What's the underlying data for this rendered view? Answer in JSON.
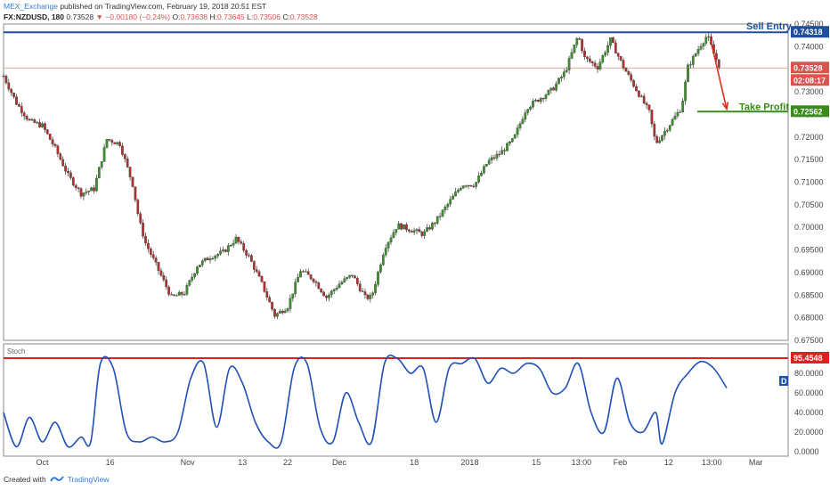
{
  "header": {
    "publisher": "MEX_Exchange",
    "published_text": "published on TradingView.com, February 19, 2018 20:51 EST",
    "symbol": "FX:NZDUSD, 180",
    "last": "0.73528",
    "change": "−0.00180 (−0.24%)",
    "o_label": "O:",
    "o": "0.73638",
    "h_label": "H:",
    "h": "0.73645",
    "l_label": "L:",
    "l": "0.73506",
    "c_label": "C:",
    "c": "0.73528"
  },
  "footer": {
    "created_with": "Created with",
    "brand": "TradingView"
  },
  "chart_data": {
    "type": "candlestick",
    "symbol": "NZDUSD",
    "timeframe": "180",
    "price_axis": {
      "min": 0.675,
      "max": 0.745,
      "ticks": [
        "0.74500",
        "0.74000",
        "0.73500",
        "0.73000",
        "0.72500",
        "0.72000",
        "0.71500",
        "0.71000",
        "0.70500",
        "0.70000",
        "0.69500",
        "0.69000",
        "0.68500",
        "0.68000",
        "0.67500"
      ]
    },
    "time_axis": {
      "labels": [
        {
          "t": 0.06,
          "text": "Oct"
        },
        {
          "t": 0.165,
          "text": "16"
        },
        {
          "t": 0.285,
          "text": "Nov"
        },
        {
          "t": 0.37,
          "text": "13"
        },
        {
          "t": 0.44,
          "text": "22"
        },
        {
          "t": 0.52,
          "text": "Dec"
        },
        {
          "t": 0.636,
          "text": "18"
        },
        {
          "t": 0.722,
          "text": "2018"
        },
        {
          "t": 0.825,
          "text": "15"
        },
        {
          "t": 0.895,
          "text": "13:00"
        },
        {
          "t": 0.955,
          "text": "Feb"
        },
        {
          "t": 1.03,
          "text": "12"
        },
        {
          "t": 1.097,
          "text": "13:00"
        },
        {
          "t": 1.165,
          "text": "Mar"
        }
      ]
    },
    "price_path": [
      {
        "t": 0.0,
        "p": 0.7335
      },
      {
        "t": 0.02,
        "p": 0.7275
      },
      {
        "t": 0.04,
        "p": 0.7235
      },
      {
        "t": 0.06,
        "p": 0.7225
      },
      {
        "t": 0.08,
        "p": 0.7175
      },
      {
        "t": 0.1,
        "p": 0.7115
      },
      {
        "t": 0.12,
        "p": 0.7075
      },
      {
        "t": 0.14,
        "p": 0.7085
      },
      {
        "t": 0.16,
        "p": 0.7195
      },
      {
        "t": 0.18,
        "p": 0.7185
      },
      {
        "t": 0.2,
        "p": 0.7095
      },
      {
        "t": 0.21,
        "p": 0.7015
      },
      {
        "t": 0.22,
        "p": 0.6965
      },
      {
        "t": 0.24,
        "p": 0.6905
      },
      {
        "t": 0.26,
        "p": 0.6845
      },
      {
        "t": 0.28,
        "p": 0.6855
      },
      {
        "t": 0.3,
        "p": 0.6915
      },
      {
        "t": 0.32,
        "p": 0.6935
      },
      {
        "t": 0.34,
        "p": 0.6945
      },
      {
        "t": 0.36,
        "p": 0.6975
      },
      {
        "t": 0.38,
        "p": 0.6935
      },
      {
        "t": 0.4,
        "p": 0.6875
      },
      {
        "t": 0.42,
        "p": 0.6805
      },
      {
        "t": 0.44,
        "p": 0.6825
      },
      {
        "t": 0.46,
        "p": 0.6905
      },
      {
        "t": 0.48,
        "p": 0.6885
      },
      {
        "t": 0.5,
        "p": 0.6845
      },
      {
        "t": 0.52,
        "p": 0.6875
      },
      {
        "t": 0.54,
        "p": 0.6895
      },
      {
        "t": 0.56,
        "p": 0.6845
      },
      {
        "t": 0.57,
        "p": 0.6845
      },
      {
        "t": 0.59,
        "p": 0.6955
      },
      {
        "t": 0.61,
        "p": 0.7005
      },
      {
        "t": 0.63,
        "p": 0.6995
      },
      {
        "t": 0.65,
        "p": 0.6985
      },
      {
        "t": 0.67,
        "p": 0.7015
      },
      {
        "t": 0.69,
        "p": 0.7055
      },
      {
        "t": 0.71,
        "p": 0.7095
      },
      {
        "t": 0.73,
        "p": 0.7095
      },
      {
        "t": 0.75,
        "p": 0.7145
      },
      {
        "t": 0.77,
        "p": 0.7165
      },
      {
        "t": 0.79,
        "p": 0.7195
      },
      {
        "t": 0.81,
        "p": 0.7265
      },
      {
        "t": 0.83,
        "p": 0.7285
      },
      {
        "t": 0.85,
        "p": 0.7305
      },
      {
        "t": 0.87,
        "p": 0.7345
      },
      {
        "t": 0.89,
        "p": 0.7425
      },
      {
        "t": 0.9,
        "p": 0.7375
      },
      {
        "t": 0.92,
        "p": 0.7355
      },
      {
        "t": 0.94,
        "p": 0.7415
      },
      {
        "t": 0.96,
        "p": 0.7355
      },
      {
        "t": 0.98,
        "p": 0.7305
      },
      {
        "t": 1.0,
        "p": 0.7255
      },
      {
        "t": 1.01,
        "p": 0.7185
      },
      {
        "t": 1.03,
        "p": 0.7225
      },
      {
        "t": 1.05,
        "p": 0.7265
      },
      {
        "t": 1.06,
        "p": 0.7355
      },
      {
        "t": 1.08,
        "p": 0.7405
      },
      {
        "t": 1.09,
        "p": 0.7425
      },
      {
        "t": 1.1,
        "p": 0.7385
      },
      {
        "t": 1.11,
        "p": 0.7353
      }
    ],
    "levels": [
      {
        "name": "sell-entry",
        "label": "Sell Entry",
        "price": 0.74318,
        "value_text": "0.74318",
        "color": "#1f4e9c"
      },
      {
        "name": "take-profit",
        "label": "Take Profit",
        "price": 0.72562,
        "value_text": "0.72562",
        "color": "#3a8a1c"
      },
      {
        "name": "last-price",
        "price": 0.73528,
        "value_text": "0.73528",
        "color": "#e0a080",
        "badge_color": "#d9534f"
      }
    ],
    "countdown": "02:08:17",
    "arrow": {
      "from": {
        "t": 1.095,
        "p": 0.7415
      },
      "to": {
        "t": 1.12,
        "p": 0.7262
      },
      "color": "#d9311c"
    },
    "stoch": {
      "label": "Stoch",
      "axis_ticks": [
        "80.0000",
        "60.0000",
        "40.0000",
        "20.0000",
        "0.0000"
      ],
      "overbought_level": 95.4548,
      "overbought_text": "95.4548",
      "d_badge": "D",
      "values": [
        {
          "t": 0.0,
          "v": 40
        },
        {
          "t": 0.02,
          "v": 5
        },
        {
          "t": 0.04,
          "v": 35
        },
        {
          "t": 0.06,
          "v": 10
        },
        {
          "t": 0.08,
          "v": 30
        },
        {
          "t": 0.1,
          "v": 5
        },
        {
          "t": 0.12,
          "v": 15
        },
        {
          "t": 0.135,
          "v": 10
        },
        {
          "t": 0.15,
          "v": 90
        },
        {
          "t": 0.17,
          "v": 85
        },
        {
          "t": 0.19,
          "v": 20
        },
        {
          "t": 0.21,
          "v": 10
        },
        {
          "t": 0.23,
          "v": 15
        },
        {
          "t": 0.25,
          "v": 10
        },
        {
          "t": 0.27,
          "v": 20
        },
        {
          "t": 0.29,
          "v": 75
        },
        {
          "t": 0.31,
          "v": 90
        },
        {
          "t": 0.33,
          "v": 25
        },
        {
          "t": 0.35,
          "v": 85
        },
        {
          "t": 0.37,
          "v": 70
        },
        {
          "t": 0.39,
          "v": 30
        },
        {
          "t": 0.41,
          "v": 10
        },
        {
          "t": 0.43,
          "v": 10
        },
        {
          "t": 0.45,
          "v": 85
        },
        {
          "t": 0.47,
          "v": 90
        },
        {
          "t": 0.49,
          "v": 25
        },
        {
          "t": 0.51,
          "v": 10
        },
        {
          "t": 0.53,
          "v": 60
        },
        {
          "t": 0.55,
          "v": 30
        },
        {
          "t": 0.57,
          "v": 10
        },
        {
          "t": 0.59,
          "v": 90
        },
        {
          "t": 0.61,
          "v": 95
        },
        {
          "t": 0.63,
          "v": 80
        },
        {
          "t": 0.65,
          "v": 85
        },
        {
          "t": 0.67,
          "v": 30
        },
        {
          "t": 0.69,
          "v": 85
        },
        {
          "t": 0.71,
          "v": 90
        },
        {
          "t": 0.73,
          "v": 95
        },
        {
          "t": 0.75,
          "v": 70
        },
        {
          "t": 0.77,
          "v": 85
        },
        {
          "t": 0.79,
          "v": 80
        },
        {
          "t": 0.81,
          "v": 90
        },
        {
          "t": 0.83,
          "v": 85
        },
        {
          "t": 0.85,
          "v": 60
        },
        {
          "t": 0.87,
          "v": 65
        },
        {
          "t": 0.89,
          "v": 90
        },
        {
          "t": 0.91,
          "v": 40
        },
        {
          "t": 0.93,
          "v": 20
        },
        {
          "t": 0.95,
          "v": 75
        },
        {
          "t": 0.97,
          "v": 30
        },
        {
          "t": 0.99,
          "v": 20
        },
        {
          "t": 1.01,
          "v": 40
        },
        {
          "t": 1.02,
          "v": 8
        },
        {
          "t": 1.04,
          "v": 60
        },
        {
          "t": 1.06,
          "v": 80
        },
        {
          "t": 1.08,
          "v": 92
        },
        {
          "t": 1.1,
          "v": 85
        },
        {
          "t": 1.12,
          "v": 65
        }
      ]
    }
  }
}
